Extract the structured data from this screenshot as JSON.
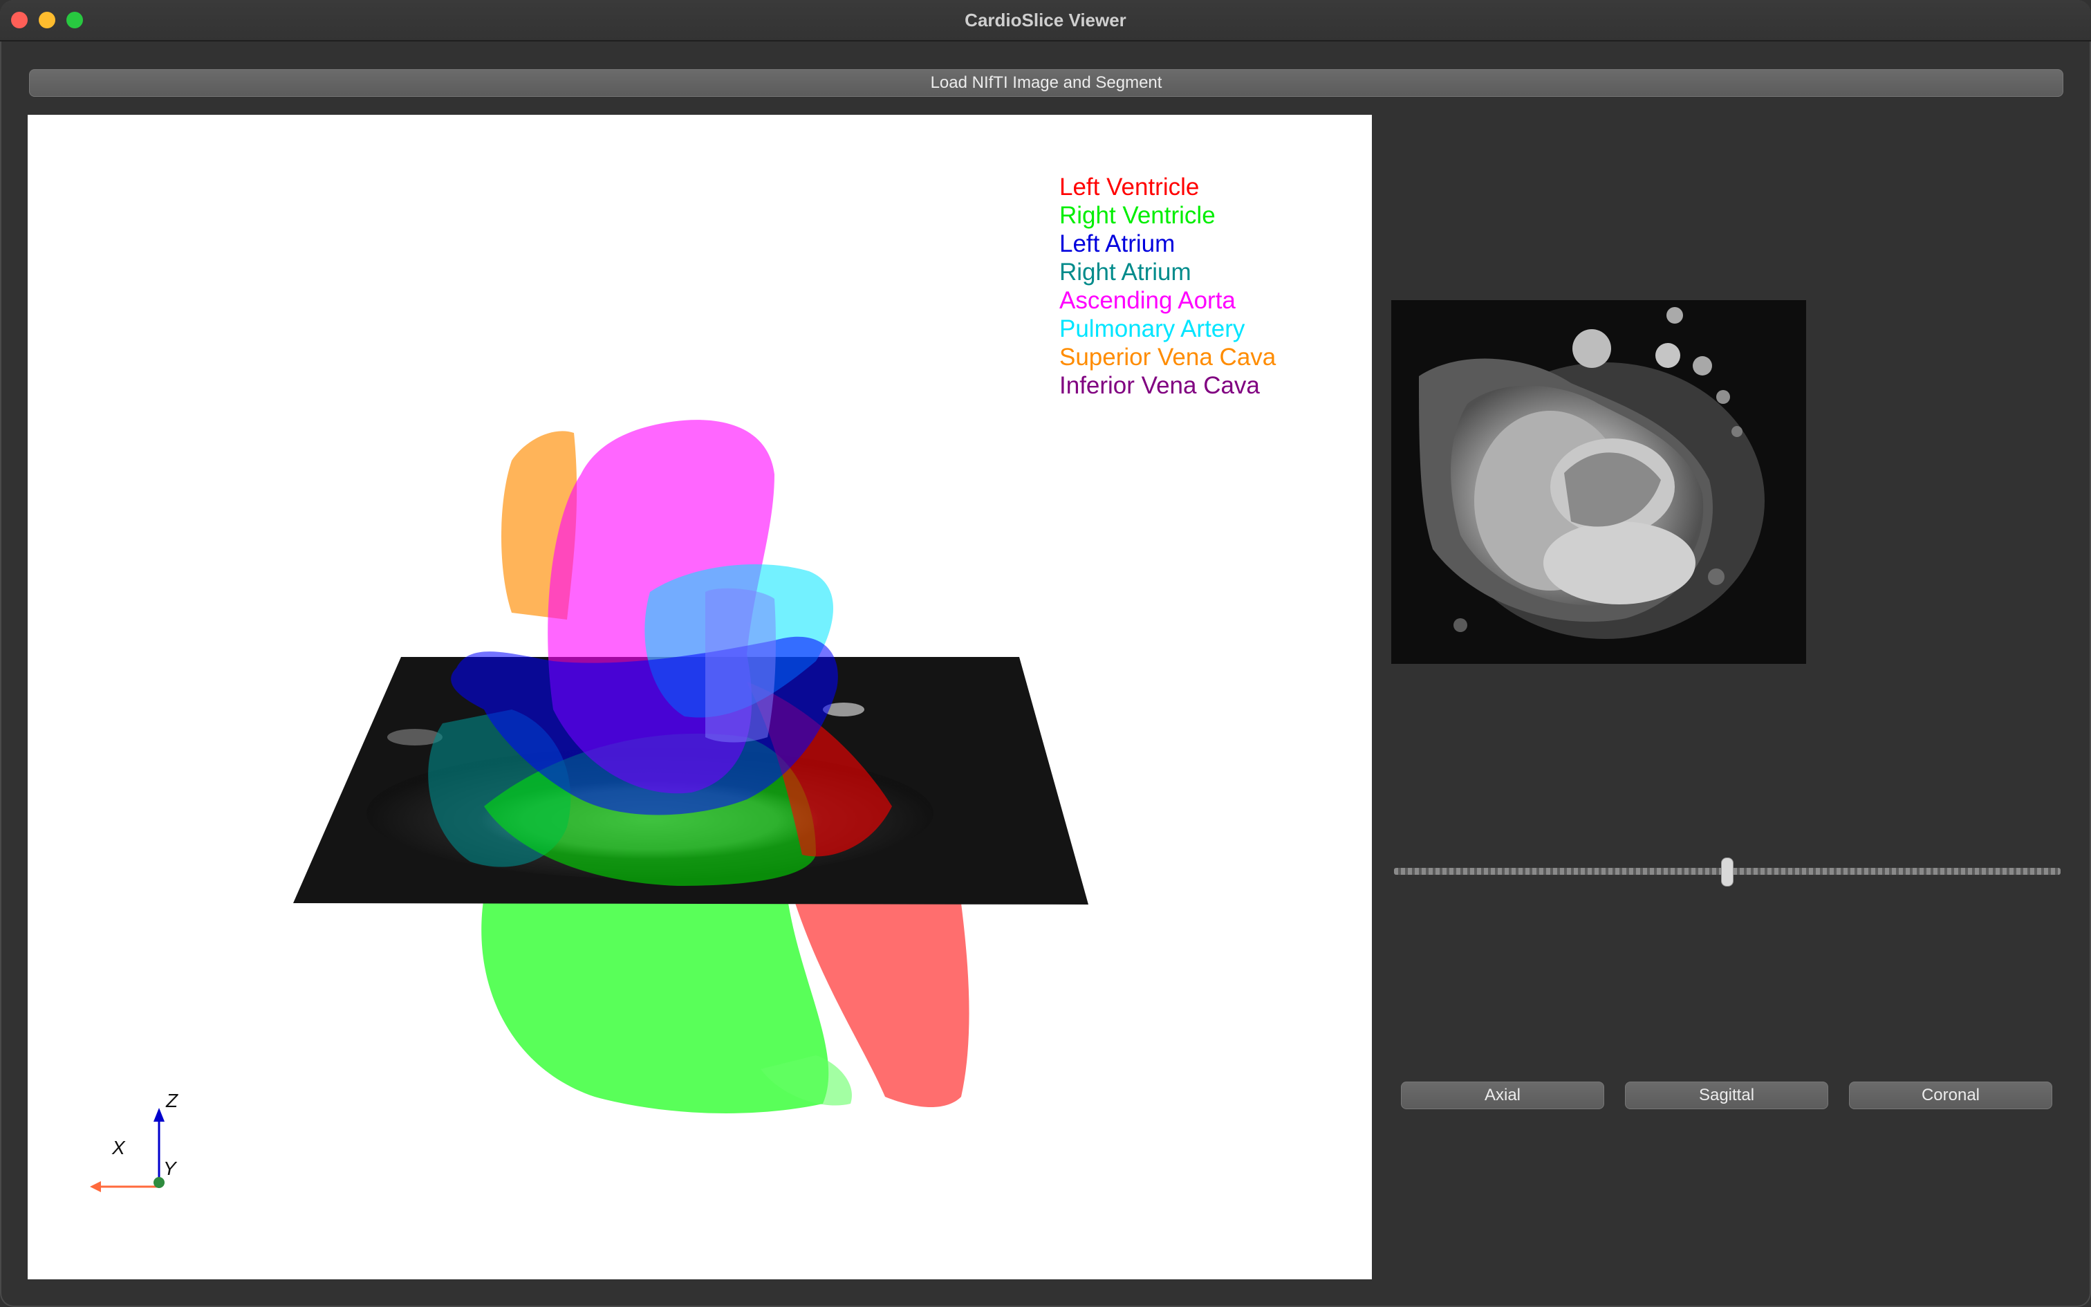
{
  "window": {
    "title": "CardioSlice Viewer"
  },
  "toolbar": {
    "load_label": "Load NIfTI Image and Segment"
  },
  "legend": [
    {
      "label": "Left Ventricle",
      "color": "#ff0000"
    },
    {
      "label": "Right Ventricle",
      "color": "#00ee00"
    },
    {
      "label": "Left Atrium",
      "color": "#0000dd"
    },
    {
      "label": "Right Atrium",
      "color": "#008b8b"
    },
    {
      "label": "Ascending Aorta",
      "color": "#ff00ff"
    },
    {
      "label": "Pulmonary Artery",
      "color": "#00e5ff"
    },
    {
      "label": "Superior Vena Cava",
      "color": "#ff8c00"
    },
    {
      "label": "Inferior Vena Cava",
      "color": "#800080"
    }
  ],
  "axes": {
    "x": "X",
    "y": "Y",
    "z": "Z"
  },
  "slider": {
    "value": 0.5
  },
  "view_buttons": {
    "axial": "Axial",
    "sagittal": "Sagittal",
    "coronal": "Coronal"
  }
}
